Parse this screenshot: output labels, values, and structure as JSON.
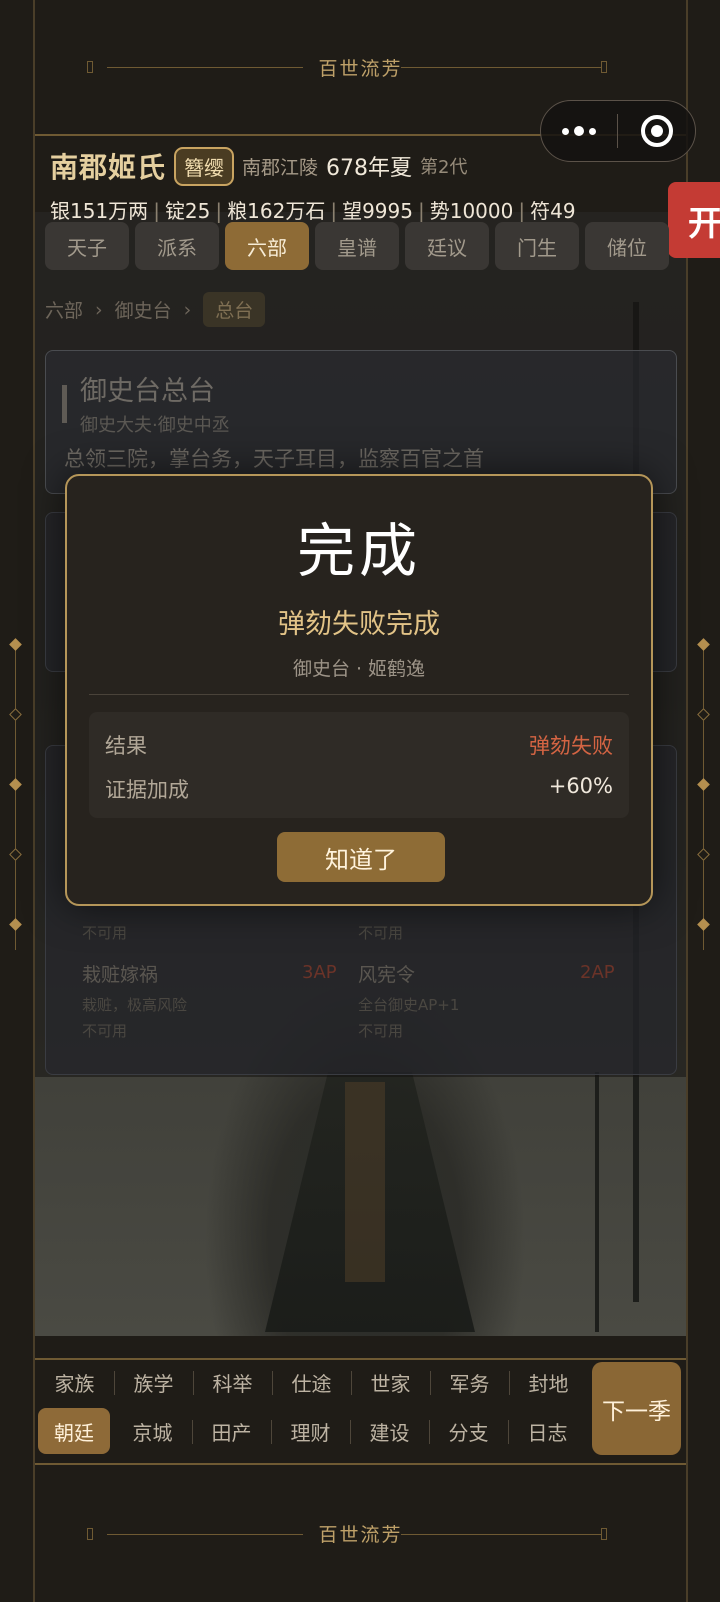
{
  "banner": {
    "top": "百世流芳",
    "bottom": "百世流芳"
  },
  "side_tab": "开",
  "header": {
    "clan": "南郡姬氏",
    "badge": "簪缨",
    "location": "南郡江陵",
    "season": "678年夏",
    "generation": "第2代"
  },
  "resources": [
    "银151万两",
    "锭25",
    "粮162万石",
    "望9995",
    "势10000",
    "符49"
  ],
  "tabs": [
    {
      "label": "天子",
      "active": false
    },
    {
      "label": "派系",
      "active": false
    },
    {
      "label": "六部",
      "active": true
    },
    {
      "label": "皇谱",
      "active": false
    },
    {
      "label": "廷议",
      "active": false
    },
    {
      "label": "门生",
      "active": false
    },
    {
      "label": "储位",
      "active": false
    }
  ],
  "breadcrumb": [
    "六部",
    "御史台",
    "总台"
  ],
  "office_card": {
    "title": "御史台总台",
    "subtitle": "御史大夫·御史中丞",
    "description": "总领三院，掌台务，天子耳目，监察百官之首"
  },
  "background_actions": [
    {
      "name": "栽赃嫁祸",
      "ap": "3AP",
      "desc": "栽赃，极高风险",
      "status": "不可用"
    },
    {
      "name": "风宪令",
      "ap": "2AP",
      "desc": "全台御史AP+1",
      "status": "不可用"
    },
    {
      "status_upper_left": "不可用",
      "status_upper_right": "不可用"
    }
  ],
  "dialog": {
    "title": "完成",
    "subtitle": "弹劾失败完成",
    "meta": "御史台 · 姬鹤逸",
    "rows": [
      {
        "key": "结果",
        "value": "弹劾失败"
      },
      {
        "key": "证据加成",
        "value": "+60%"
      }
    ],
    "ok_label": "知道了"
  },
  "bottom_nav": {
    "row1": [
      "家族",
      "族学",
      "科举",
      "仕途",
      "世家",
      "军务",
      "封地"
    ],
    "row2": [
      "朝廷",
      "京城",
      "田产",
      "理财",
      "建设",
      "分支",
      "日志"
    ],
    "active": "朝廷",
    "next_label": "下一季"
  },
  "colors": {
    "accent_gold": "#b59659",
    "active_tab": "#8e6b36",
    "fail_red": "#d46443"
  }
}
